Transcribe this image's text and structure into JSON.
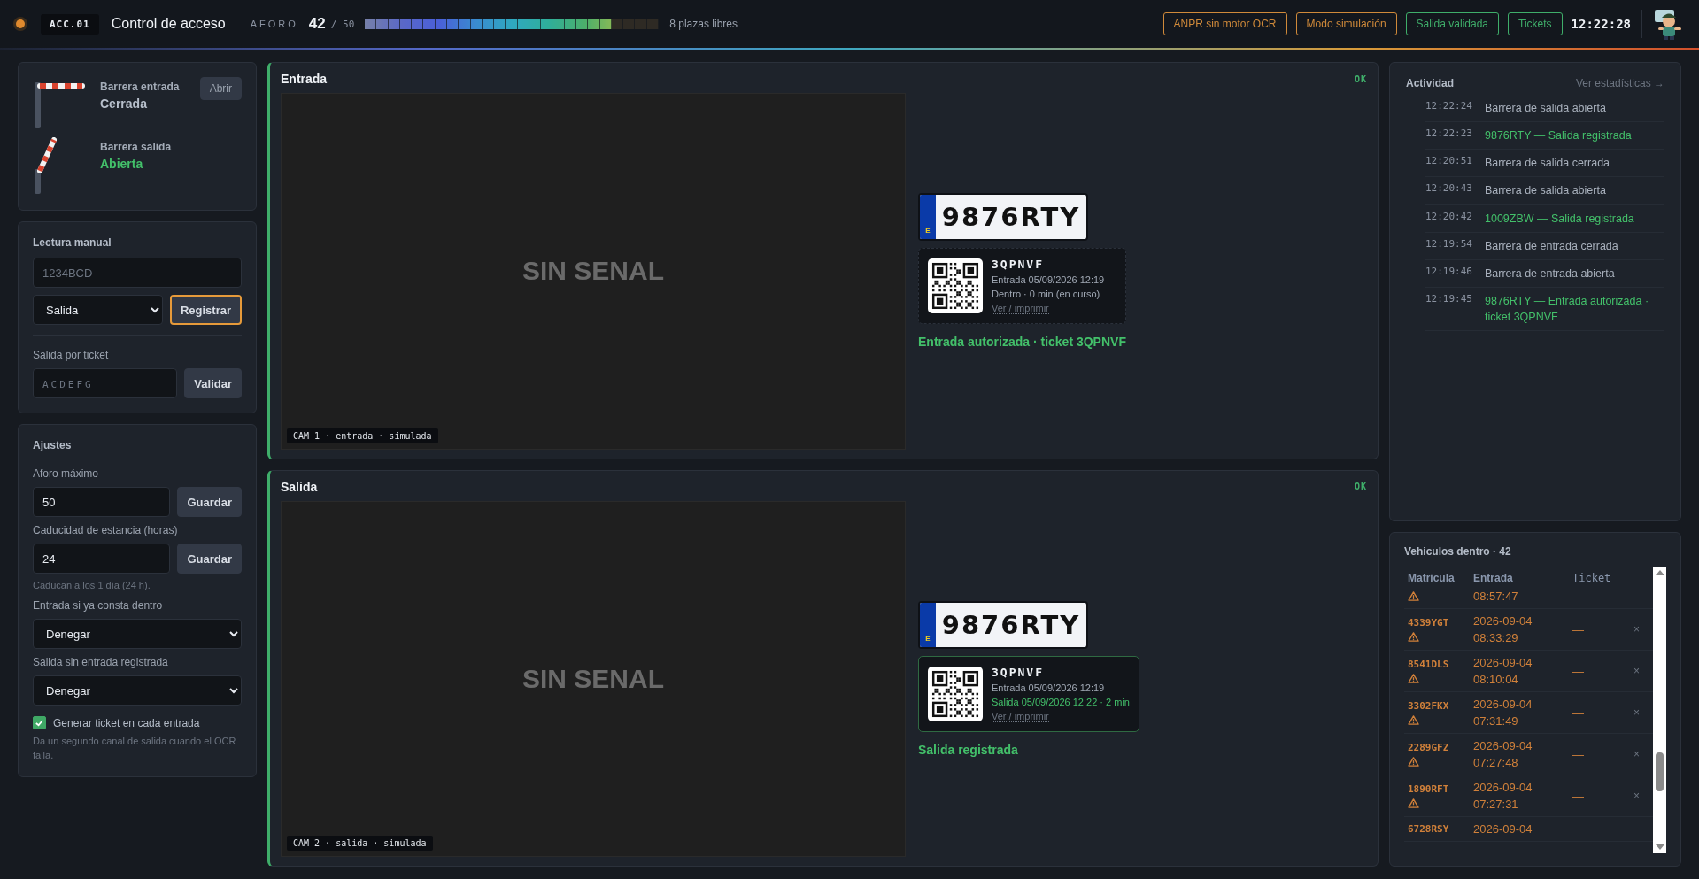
{
  "header": {
    "status": {
      "color": "#e08a2e"
    },
    "station": "ACC.01",
    "title": "Control de acceso",
    "capacity": {
      "label": "AFORO",
      "count": "42",
      "max": "/ 50",
      "level": 0.84,
      "free": "8 plazas libres"
    },
    "badges": [
      {
        "label": "ANPR sin motor OCR",
        "color": "#d08a3a"
      },
      {
        "label": "Modo simulación",
        "color": "#d08a3a"
      },
      {
        "label": "Salida validada",
        "color": "#3fae6a"
      },
      {
        "label": "Tickets",
        "color": "#3fae6a"
      }
    ],
    "clock": "12:22:28"
  },
  "barriers": [
    {
      "label": "Barrera entrada",
      "state": "Cerrada",
      "open": false,
      "action": "Abrir"
    },
    {
      "label": "Barrera salida",
      "state": "Abierta",
      "open": true
    }
  ],
  "manual": {
    "title": "Lectura manual",
    "plate_placeholder": "1234BCD",
    "direction": "Salida",
    "submit": "Registrar",
    "submit_focused": true,
    "ticket_label": "Salida por ticket",
    "ticket_placeholder": "ACDEFG",
    "validate": "Validar"
  },
  "settings": {
    "title": "Ajustes",
    "fields": [
      {
        "kind": "input",
        "label": "Aforo máximo",
        "value": "50",
        "button": "Guardar"
      },
      {
        "kind": "input",
        "label": "Caducidad de estancia (horas)",
        "value": "24",
        "button": "Guardar",
        "hint": "Caducan a los 1 día (24 h)."
      },
      {
        "kind": "select",
        "label": "Entrada si ya consta dentro",
        "value": "Denegar"
      },
      {
        "kind": "select",
        "label": "Salida sin entrada registrada",
        "value": "Denegar"
      },
      {
        "kind": "checkbox",
        "label": "Generar ticket en cada entrada",
        "checked": true,
        "hint": "Da un segundo canal de salida cuando el OCR falla."
      }
    ]
  },
  "lanes": [
    {
      "title": "Entrada",
      "status": "OK",
      "feed": {
        "message": "SIN SENAL",
        "caption": "CAM 1 · entrada · simulada"
      },
      "plate": {
        "country": "E",
        "number": "9876RTY"
      },
      "ticket": {
        "code": "3QPNVF",
        "closed": false,
        "lines": [
          {
            "kind": "muted",
            "text": "Entrada 05/09/2026 12:19"
          },
          {
            "kind": "muted",
            "text": "Dentro · 0 min (en curso)"
          }
        ],
        "link": "Ver / imprimir"
      },
      "result": "Entrada autorizada · ticket 3QPNVF"
    },
    {
      "title": "Salida",
      "status": "OK",
      "feed": {
        "message": "SIN SENAL",
        "caption": "CAM 2 · salida · simulada"
      },
      "plate": {
        "country": "E",
        "number": "9876RTY"
      },
      "ticket": {
        "code": "3QPNVF",
        "closed": true,
        "lines": [
          {
            "kind": "muted",
            "text": "Entrada 05/09/2026 12:19"
          },
          {
            "kind": "success",
            "text": "Salida 05/09/2026 12:22 · 2 min"
          }
        ],
        "link": "Ver / imprimir"
      },
      "result": "Salida registrada"
    }
  ],
  "activity": {
    "title": "Actividad",
    "link": "Ver estadísticas →",
    "items": [
      {
        "time": "12:22:24",
        "text": "Barrera de salida abierta",
        "kind": "info"
      },
      {
        "time": "12:22:23",
        "text": "9876RTY — Salida registrada",
        "kind": "success"
      },
      {
        "time": "12:20:51",
        "text": "Barrera de salida cerrada",
        "kind": "info"
      },
      {
        "time": "12:20:43",
        "text": "Barrera de salida abierta",
        "kind": "info"
      },
      {
        "time": "12:20:42",
        "text": "1009ZBW — Salida registrada",
        "kind": "success"
      },
      {
        "time": "12:19:54",
        "text": "Barrera de entrada cerrada",
        "kind": "info"
      },
      {
        "time": "12:19:46",
        "text": "Barrera de entrada abierta",
        "kind": "info"
      },
      {
        "time": "12:19:45",
        "text": "9876RTY — Entrada autorizada · ticket 3QPNVF",
        "kind": "success"
      }
    ]
  },
  "vehicles": {
    "title": "Vehiculos dentro · **42**",
    "columns": [
      "Matricula",
      "Entrada",
      "Ticket"
    ],
    "rows": [
      {
        "warning": true,
        "time": "08:57:47"
      },
      {
        "plate": "4339YGT",
        "warning": true,
        "date": "2026-09-04",
        "time": "08:33:29",
        "ticket": "—",
        "remove": "×"
      },
      {
        "plate": "8541DLS",
        "warning": true,
        "date": "2026-09-04",
        "time": "08:10:04",
        "ticket": "—",
        "remove": "×"
      },
      {
        "plate": "3302FKX",
        "warning": true,
        "date": "2026-09-04",
        "time": "07:31:49",
        "ticket": "—",
        "remove": "×"
      },
      {
        "plate": "2289GFZ",
        "warning": true,
        "date": "2026-09-04",
        "time": "07:27:48",
        "ticket": "—",
        "remove": "×"
      },
      {
        "plate": "1890RFT",
        "warning": true,
        "date": "2026-09-04",
        "time": "07:27:31",
        "ticket": "—",
        "remove": "×"
      },
      {
        "plate": "6728RSY",
        "date": "2026-09-04"
      }
    ]
  }
}
